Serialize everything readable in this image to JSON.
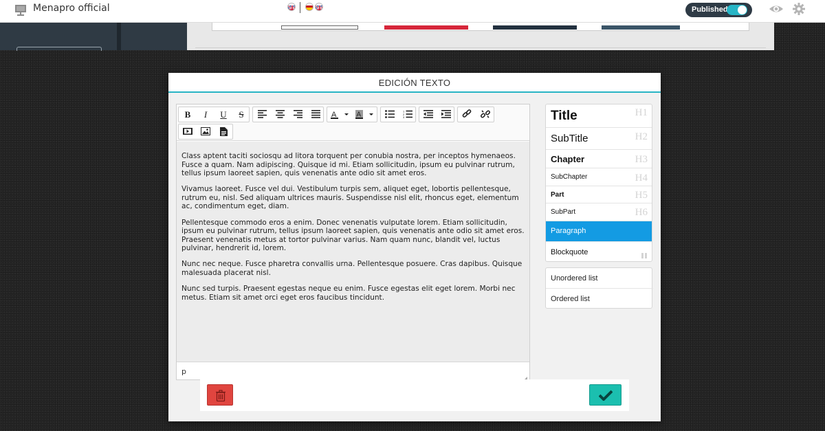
{
  "app": {
    "title": "Menapro official"
  },
  "header": {
    "published_label": "Published",
    "published_on": true,
    "languages": [
      "English",
      "Spanish",
      "English"
    ]
  },
  "modal": {
    "title": "EDICIÓN TEXTO",
    "status_path": "p",
    "paragraphs": [
      "Class aptent taciti sociosqu ad litora torquent per conubia nostra, per inceptos hymenaeos. Fusce a quam. Nam adipiscing. Quisque id mi. Etiam sollicitudin, ipsum eu pulvinar rutrum, tellus ipsum laoreet sapien, quis venenatis ante odio sit amet eros.",
      "Vivamus laoreet. Fusce vel dui. Vestibulum turpis sem, aliquet eget, lobortis pellentesque, rutrum eu, nisl. Sed aliquam ultrices mauris. Suspendisse nisl elit, rhoncus eget, elementum ac, condimentum eget, diam.",
      "Pellentesque commodo eros a enim. Donec venenatis vulputate lorem. Etiam sollicitudin, ipsum eu pulvinar rutrum, tellus ipsum laoreet sapien, quis venenatis ante odio sit amet eros. Praesent venenatis metus at tortor pulvinar varius. Nam quam nunc, blandit vel, luctus pulvinar, hendrerit id, lorem.",
      "Nunc nec neque. Fusce pharetra convallis urna. Pellentesque posuere. Cras dapibus. Quisque malesuada placerat nisl.",
      "Nunc sed turpis. Praesent egestas neque eu enim. Fusce egestas elit eget lorem. Morbi nec metus. Etiam sit amet orci eget eros faucibus tincidunt."
    ]
  },
  "toolbar": {
    "bold_label": "B",
    "italic_label": "I",
    "underline_label": "U",
    "strike_label": "S"
  },
  "styles": {
    "items": [
      {
        "label": "Title",
        "tag": "H1"
      },
      {
        "label": "SubTitle",
        "tag": "H2"
      },
      {
        "label": "Chapter",
        "tag": "H3"
      },
      {
        "label": "SubChapter",
        "tag": "H4"
      },
      {
        "label": "Part",
        "tag": "H5"
      },
      {
        "label": "SubPart",
        "tag": "H6"
      },
      {
        "label": "Paragraph",
        "tag": ""
      },
      {
        "label": "Blockquote",
        "tag": ""
      }
    ],
    "active": "Paragraph"
  },
  "lists": {
    "items": [
      {
        "label": "Unordered list"
      },
      {
        "label": "Ordered list"
      }
    ]
  },
  "colors": {
    "accent": "#28b4c4",
    "active_style": "#139be3",
    "delete": "#e0453f",
    "confirm": "#1bbfaf",
    "published_pill": "#2e3a45"
  },
  "icons": {
    "app": "presentation-board-icon",
    "preview": "eye-icon",
    "settings": "gear-icon",
    "delete": "trash-icon",
    "confirm": "checkmark-icon"
  }
}
